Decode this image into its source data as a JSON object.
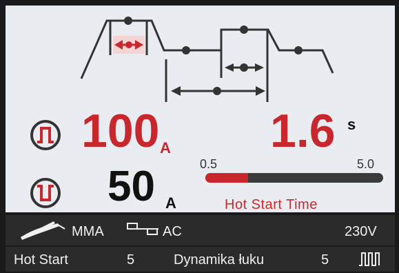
{
  "colors": {
    "accent": "#c8282d",
    "background": "#e9ecf1",
    "bar": "#2b2b2b"
  },
  "main": {
    "current_primary": {
      "value": "100",
      "unit": "A",
      "icon": "pulse-high-icon"
    },
    "current_secondary": {
      "value": "50",
      "unit": "A",
      "icon": "pulse-low-icon"
    },
    "time": {
      "value": "1.6",
      "unit": "s"
    },
    "slider": {
      "min_label": "0.5",
      "max_label": "5.0",
      "level": 0.24
    },
    "parameter_label": "Hot Start Time"
  },
  "status": {
    "process_icon": "electrode-holder-icon",
    "process": "MMA",
    "waveform_icon": "ac-waveform-icon",
    "mode": "AC",
    "voltage": "230V"
  },
  "info": {
    "hot_start_label": "Hot Start",
    "hot_start_value": "5",
    "arc_force_label": "Dynamika łuku",
    "arc_force_value": "5",
    "pulse_icon": "pulse-mode-icon"
  }
}
